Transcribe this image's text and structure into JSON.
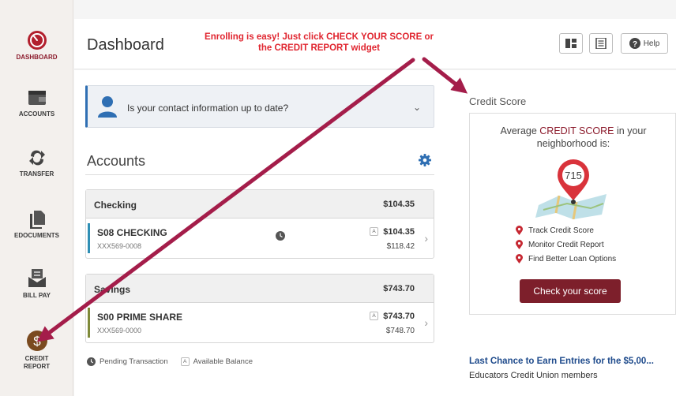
{
  "sidebar": {
    "items": [
      {
        "label": "DASHBOARD",
        "icon": "speedometer-icon",
        "active": true
      },
      {
        "label": "ACCOUNTS",
        "icon": "wallet-icon",
        "active": false
      },
      {
        "label": "TRANSFER",
        "icon": "transfer-arrows-icon",
        "active": false
      },
      {
        "label": "EDOCUMENTS",
        "icon": "documents-icon",
        "active": false
      },
      {
        "label": "BILL PAY",
        "icon": "bill-pay-icon",
        "active": false
      },
      {
        "label": "CREDIT\nREPORT",
        "icon": "dollar-icon",
        "active": false
      }
    ]
  },
  "header": {
    "title": "Dashboard",
    "annotation": "Enrolling is easy! Just click CHECK YOUR SCORE or the CREDIT REPORT widget",
    "help_label": "Help"
  },
  "contact_banner": {
    "text": "Is your contact information up to date?"
  },
  "accounts": {
    "title": "Accounts",
    "groups": [
      {
        "title": "Checking",
        "total": "$104.35",
        "rows": [
          {
            "name": "S08 CHECKING",
            "number": "XXX569-0008",
            "available": "$104.35",
            "current": "$118.42",
            "pending": true,
            "bar_color": "#2f8fb5"
          }
        ]
      },
      {
        "title": "Savings",
        "total": "$743.70",
        "rows": [
          {
            "name": "S00 PRIME SHARE",
            "number": "XXX569-0000",
            "available": "$743.70",
            "current": "$748.70",
            "pending": false,
            "bar_color": "#7f8a3a"
          }
        ]
      }
    ],
    "available_badge": "A",
    "legend": {
      "pending": "Pending Transaction",
      "available": "Available Balance"
    }
  },
  "credit": {
    "title": "Credit Score",
    "headline_pre": "Average ",
    "headline_highlight": "CREDIT SCORE",
    "headline_post": " in your neighborhood is:",
    "score": "715",
    "features": [
      "Track Credit Score",
      "Monitor Credit Report",
      "Find Better Loan Options"
    ],
    "button": "Check your score"
  },
  "news": {
    "title": "Last Chance to Earn Entries for the $5,00...",
    "sub": "Educators Credit Union members"
  },
  "colors": {
    "brand": "#8b1a2b",
    "annotation": "#e0252f",
    "arrow": "#a41d4a",
    "link": "#1f4b8c"
  }
}
